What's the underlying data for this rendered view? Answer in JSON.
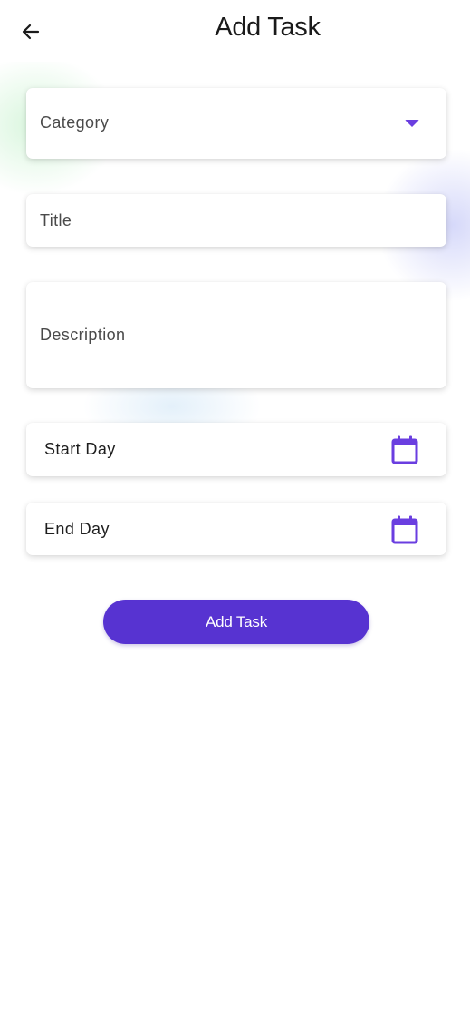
{
  "header": {
    "title": "Add Task",
    "back_icon": "arrow-left-icon"
  },
  "form": {
    "category": {
      "label": "Category",
      "icon": "dropdown-arrow-icon"
    },
    "title": {
      "placeholder": "Title"
    },
    "description": {
      "placeholder": "Description"
    },
    "start_day": {
      "label": "Start Day",
      "icon": "calendar-icon"
    },
    "end_day": {
      "label": "End Day",
      "icon": "calendar-icon"
    },
    "submit_label": "Add Task"
  },
  "colors": {
    "accent": "#5733d1",
    "icon": "#6a3ee0"
  }
}
